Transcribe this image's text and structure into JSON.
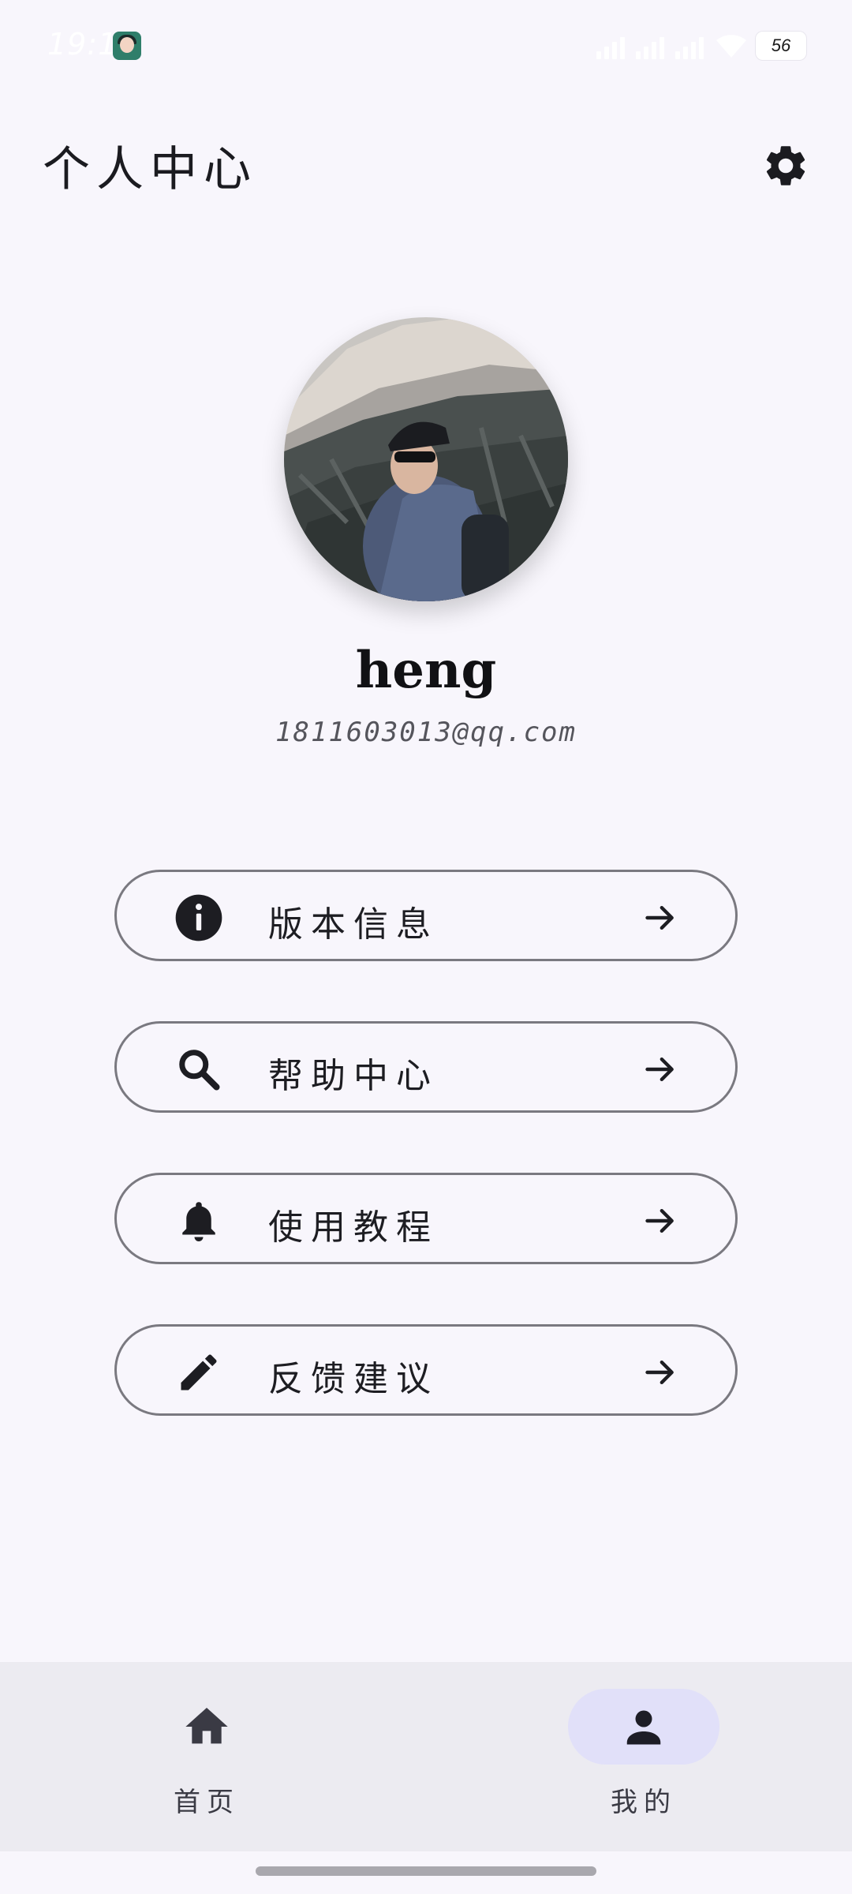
{
  "status_bar": {
    "time": "19:16",
    "battery": "56"
  },
  "header": {
    "title": "个人中心"
  },
  "profile": {
    "username": "heng",
    "email": "1811603013@qq.com"
  },
  "menu": [
    {
      "label": "版本信息",
      "icon": "info-icon"
    },
    {
      "label": "帮助中心",
      "icon": "search-icon"
    },
    {
      "label": "使用教程",
      "icon": "bell-icon"
    },
    {
      "label": "反馈建议",
      "icon": "pencil-icon"
    }
  ],
  "bottom_nav": {
    "items": [
      {
        "label": "首页",
        "icon": "home-icon",
        "active": false
      },
      {
        "label": "我的",
        "icon": "person-icon",
        "active": true
      }
    ]
  },
  "colors": {
    "background": "#f8f6fc",
    "nav_background": "#ecebf1",
    "active_pill": "#e1e0f9",
    "outline": "#7a7980"
  }
}
